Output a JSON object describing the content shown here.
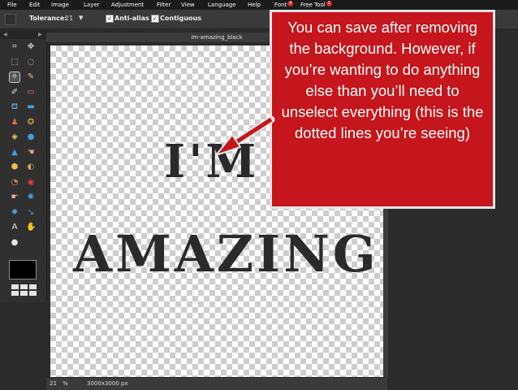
{
  "menu": {
    "items": [
      "File",
      "Edit",
      "Image",
      "Layer",
      "Adjustment",
      "Filter",
      "View",
      "Language",
      "Help"
    ],
    "font_label": "Font",
    "font_badge": "4",
    "free_tool_label": "Free Tool",
    "free_tool_badge": "1"
  },
  "options": {
    "tolerance_label": "Tolerance:",
    "tolerance_value": "21",
    "antialias_label": "Anti-alias",
    "contiguous_label": "Contiguous"
  },
  "document": {
    "title": "im-amazing_black",
    "art_line1": "I'M",
    "art_line2": "AMAZING",
    "zoom": "21",
    "zoom_unit": "%",
    "dimensions": "3000x3000 px"
  },
  "callout": {
    "text": "You can save after removing the background. However, if you’re wanting to do anything else than you’ll need to unselect everything (this is the dotted lines you’re seeing)"
  },
  "tools": [
    {
      "name": "crop-icon",
      "glyph": "⌗",
      "color": "#d8d8d8"
    },
    {
      "name": "move-icon",
      "glyph": "✥",
      "color": "#d8d8d8"
    },
    {
      "name": "marquee-icon",
      "glyph": "⬚",
      "color": "#d8d8d8"
    },
    {
      "name": "lasso-icon",
      "glyph": "◌",
      "color": "#d8d8d8"
    },
    {
      "name": "magic-wand-icon",
      "glyph": "✧",
      "color": "#ffffff"
    },
    {
      "name": "pencil-icon",
      "glyph": "✎",
      "color": "#e8c86a"
    },
    {
      "name": "brush-icon",
      "glyph": "✐",
      "color": "#d8d8d8"
    },
    {
      "name": "eraser-icon",
      "glyph": "▭",
      "color": "#e86b9a"
    },
    {
      "name": "bucket-icon",
      "glyph": "⛾",
      "color": "#6aa8e8"
    },
    {
      "name": "gradient-icon",
      "glyph": "▬",
      "color": "#4aa0e0"
    },
    {
      "name": "clone-stamp-icon",
      "glyph": "♟",
      "color": "#e07050"
    },
    {
      "name": "color-replace-icon",
      "glyph": "✪",
      "color": "#e0a040"
    },
    {
      "name": "draw-icon",
      "glyph": "◈",
      "color": "#e8d060"
    },
    {
      "name": "blur-icon",
      "glyph": "●",
      "color": "#4a9ae0"
    },
    {
      "name": "sharpen-icon",
      "glyph": "▲",
      "color": "#4a9ae0"
    },
    {
      "name": "smudge-icon",
      "glyph": "☚",
      "color": "#e8a080"
    },
    {
      "name": "sponge-icon",
      "glyph": "⬢",
      "color": "#e8c040"
    },
    {
      "name": "dodge-icon",
      "glyph": "◐",
      "color": "#e0a060"
    },
    {
      "name": "burn-icon",
      "glyph": "◔",
      "color": "#e09060"
    },
    {
      "name": "red-eye-icon",
      "glyph": "◉",
      "color": "#e04040"
    },
    {
      "name": "spot-heal-icon",
      "glyph": "☛",
      "color": "#e8b090"
    },
    {
      "name": "bloat-icon",
      "glyph": "✺",
      "color": "#4aa0e0"
    },
    {
      "name": "pinch-icon",
      "glyph": "✹",
      "color": "#4aa0e0"
    },
    {
      "name": "color-picker-icon",
      "glyph": "↘",
      "color": "#4aa0e0"
    },
    {
      "name": "type-icon",
      "glyph": "A",
      "color": "#e6e6e6"
    },
    {
      "name": "hand-icon",
      "glyph": "✋",
      "color": "#e8c090"
    },
    {
      "name": "zoom-icon",
      "glyph": "●",
      "color": "#e6e6e6"
    }
  ],
  "colors": {
    "callout_bg": "#c6161d",
    "callout_border": "#e3e3e3",
    "arrow": "#c6161d",
    "menubar_bg": "#1b1b1b",
    "panel_bg": "#303030"
  }
}
